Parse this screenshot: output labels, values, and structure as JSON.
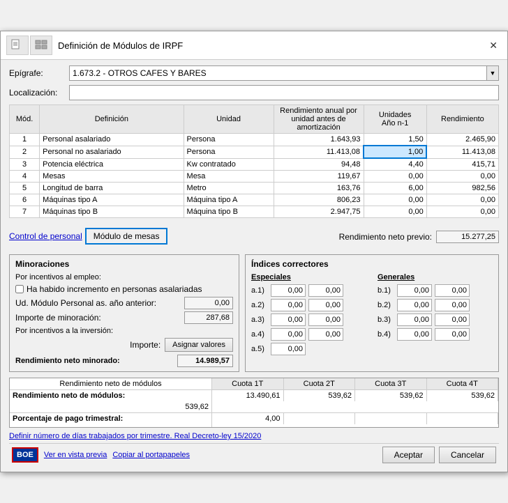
{
  "window": {
    "title": "Definición de Módulos de IRPF",
    "close_label": "✕"
  },
  "epigrafe": {
    "label": "Epígrafe:",
    "value": "1.673.2 - OTROS CAFES Y BARES"
  },
  "localizacion": {
    "label": "Localización:",
    "value": ""
  },
  "table": {
    "headers": {
      "mod": "Mód.",
      "definicion": "Definición",
      "unidad": "Unidad",
      "rendimiento": "Rendimiento anual por unidad antes de amortización",
      "unidades": "Unidades",
      "anio": "Año n-1",
      "rend_total": "Rendimiento"
    },
    "rows": [
      {
        "mod": "1",
        "definicion": "Personal asalariado",
        "unidad": "Persona",
        "rendimiento": "1.643,93",
        "unidades": "1,50",
        "rend_total": "2.465,90",
        "highlight_units": false,
        "highlight_rend": false
      },
      {
        "mod": "2",
        "definicion": "Personal no asalariado",
        "unidad": "Persona",
        "rendimiento": "11.413,08",
        "unidades": "1,00",
        "rend_total": "11.413,08",
        "highlight_units": true,
        "highlight_rend": false
      },
      {
        "mod": "3",
        "definicion": "Potencia eléctrica",
        "unidad": "Kw contratado",
        "rendimiento": "94,48",
        "unidades": "4,40",
        "rend_total": "415,71",
        "highlight_units": false,
        "highlight_rend": false
      },
      {
        "mod": "4",
        "definicion": "Mesas",
        "unidad": "Mesa",
        "rendimiento": "119,67",
        "unidades": "0,00",
        "rend_total": "0,00",
        "highlight_units": false,
        "highlight_rend": false
      },
      {
        "mod": "5",
        "definicion": "Longitud de barra",
        "unidad": "Metro",
        "rendimiento": "163,76",
        "unidades": "6,00",
        "rend_total": "982,56",
        "highlight_units": false,
        "highlight_rend": false
      },
      {
        "mod": "6",
        "definicion": "Máquinas tipo A",
        "unidad": "Máquina tipo A",
        "rendimiento": "806,23",
        "unidades": "0,00",
        "rend_total": "0,00",
        "highlight_units": false,
        "highlight_rend": false
      },
      {
        "mod": "7",
        "definicion": "Máquinas tipo B",
        "unidad": "Máquina tipo B",
        "rendimiento": "2.947,75",
        "unidades": "0,00",
        "rend_total": "0,00",
        "highlight_units": false,
        "highlight_rend": false
      }
    ]
  },
  "tabs": {
    "control_personal": "Control de personal",
    "modulo_mesas": "Módulo de mesas"
  },
  "rendimiento_neto_previo": {
    "label": "Rendimiento neto previo:",
    "value": "15.277,25"
  },
  "minoraciones": {
    "title": "Minoraciones",
    "incentivos_empleo_label": "Por incentivos al empleo:",
    "checkbox_label": "Ha habido incremento en personas asalariadas",
    "ud_modulo_label": "Ud. Módulo Personal as. año anterior:",
    "ud_modulo_value": "0,00",
    "importe_minoracion_label": "Importe de minoración:",
    "importe_minoracion_value": "287,68",
    "incentivos_inversion_label": "Por incentivos a la inversión:",
    "importe_label": "Importe:",
    "asignar_btn": "Asignar valores",
    "rendimiento_neto_minorado_label": "Rendimiento neto minorado:",
    "rendimiento_neto_minorado_value": "14.989,57"
  },
  "indices_correctores": {
    "title": "Índices correctores",
    "especiales_title": "Especiales",
    "generales_title": "Generales",
    "especiales": [
      {
        "label": "a.1)",
        "val1": "0,00",
        "val2": "0,00"
      },
      {
        "label": "a.2)",
        "val1": "0,00",
        "val2": "0,00"
      },
      {
        "label": "a.3)",
        "val1": "0,00",
        "val2": "0,00"
      },
      {
        "label": "a.4)",
        "val1": "0,00",
        "val2": "0,00"
      },
      {
        "label": "a.5)",
        "val1": "0,00",
        "val2": ""
      }
    ],
    "generales": [
      {
        "label": "b.1)",
        "val1": "0,00",
        "val2": "0,00"
      },
      {
        "label": "b.2)",
        "val1": "0,00",
        "val2": "0,00"
      },
      {
        "label": "b.3)",
        "val1": "0,00",
        "val2": "0,00"
      },
      {
        "label": "b.4)",
        "val1": "0,00",
        "val2": "0,00"
      }
    ]
  },
  "bottom_totals": {
    "row_header": "Rendimiento neto de módulos",
    "cuota_labels": [
      "Cuota 1T",
      "Cuota 2T",
      "Cuota 3T",
      "Cuota 4T"
    ],
    "rows": [
      {
        "label": "Rendimiento neto de módulos:",
        "values": [
          "13.490,61",
          "539,62",
          "539,62",
          "539,62",
          "539,62"
        ]
      },
      {
        "label": "Porcentaje de pago trimestral:",
        "values": [
          "4,00",
          "",
          "",
          "",
          ""
        ]
      }
    ]
  },
  "defin_link": "Definir número de días trabajados por trimestre. Real Decreto-ley 15/2020",
  "footer": {
    "boe_label": "BOE",
    "ver_vista_previa": "Ver en vista previa",
    "copiar_portapapeles": "Copiar al portapapeles",
    "aceptar": "Aceptar",
    "cancelar": "Cancelar"
  }
}
